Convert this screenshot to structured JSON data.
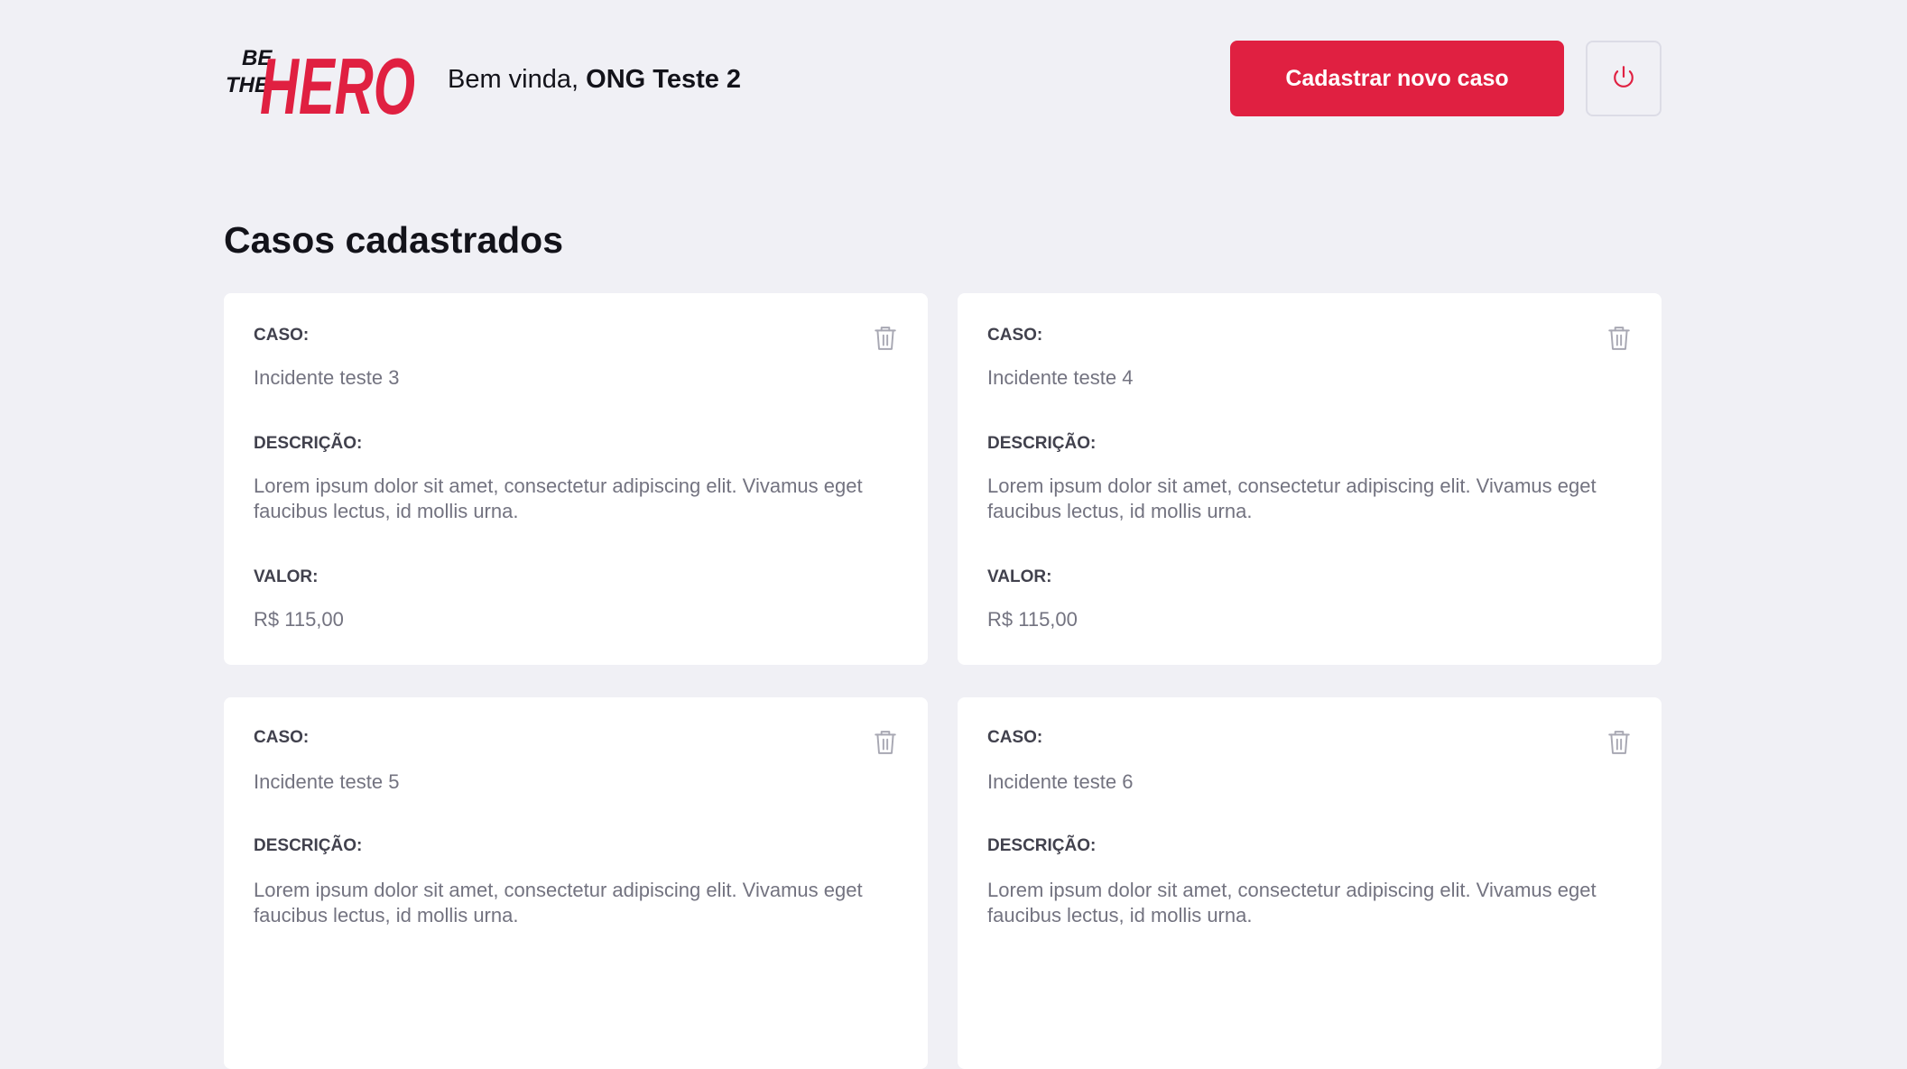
{
  "brand": {
    "logo_line1": "BE",
    "logo_line2": "THE",
    "logo_word": "HERO"
  },
  "header": {
    "greeting_prefix": "Bem vinda, ",
    "ong_name": "ONG Teste 2",
    "new_case_label": "Cadastrar novo caso",
    "logout_icon": "power-icon"
  },
  "page_title": "Casos cadastrados",
  "labels": {
    "caso": "CASO:",
    "descricao": "DESCRIÇÃO:",
    "valor": "VALOR:"
  },
  "colors": {
    "accent": "#e02041",
    "background": "#f0f0f5",
    "card": "#ffffff",
    "muted_text": "#737380",
    "label_text": "#41414d"
  },
  "cases": [
    {
      "title": "Incidente teste 3",
      "description": "Lorem ipsum dolor sit amet, consectetur adipiscing elit. Vivamus eget faucibus lectus, id mollis urna.",
      "value": "R$ 115,00"
    },
    {
      "title": "Incidente teste 4",
      "description": "Lorem ipsum dolor sit amet, consectetur adipiscing elit. Vivamus eget faucibus lectus, id mollis urna.",
      "value": "R$ 115,00"
    },
    {
      "title": "Incidente teste 5",
      "description": "Lorem ipsum dolor sit amet, consectetur adipiscing elit. Vivamus eget faucibus lectus, id mollis urna.",
      "value": ""
    },
    {
      "title": "Incidente teste 6",
      "description": "Lorem ipsum dolor sit amet, consectetur adipiscing elit. Vivamus eget faucibus lectus, id mollis urna.",
      "value": ""
    }
  ]
}
